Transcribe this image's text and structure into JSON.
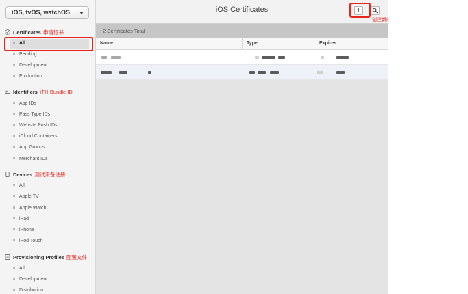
{
  "sidebar": {
    "platform_select": "iOS, tvOS, watchOS",
    "sections": {
      "certificates": {
        "label": "Certificates",
        "note": "申请证书",
        "items": [
          "All",
          "Pending",
          "Development",
          "Production"
        ]
      },
      "identifiers": {
        "label": "Identifiers",
        "note": "注册Bundle ID",
        "items": [
          "App IDs",
          "Pass Type IDs",
          "Website Push IDs",
          "iCloud Containers",
          "App Groups",
          "Merchant IDs"
        ]
      },
      "devices": {
        "label": "Devices",
        "note": "测试设备注册",
        "items": [
          "All",
          "Apple TV",
          "Apple Watch",
          "iPad",
          "iPhone",
          "iPod Touch"
        ]
      },
      "profiles": {
        "label": "Provisioning Profiles",
        "note": "配置文件",
        "items": [
          "All",
          "Development",
          "Distribution"
        ]
      }
    }
  },
  "header": {
    "title": "iOS Certificates",
    "add_button": "+",
    "search_icon": "search-icon",
    "add_note": "创建新的证书"
  },
  "table": {
    "total": "2 Certificates Total",
    "columns": [
      "Name",
      "Type",
      "Expires"
    ],
    "rows_count_visible": 2
  },
  "colors": {
    "annotation": "#e8251b",
    "sidebar_bg": "#f4f4f4",
    "main_bg": "#e4e4e4"
  }
}
